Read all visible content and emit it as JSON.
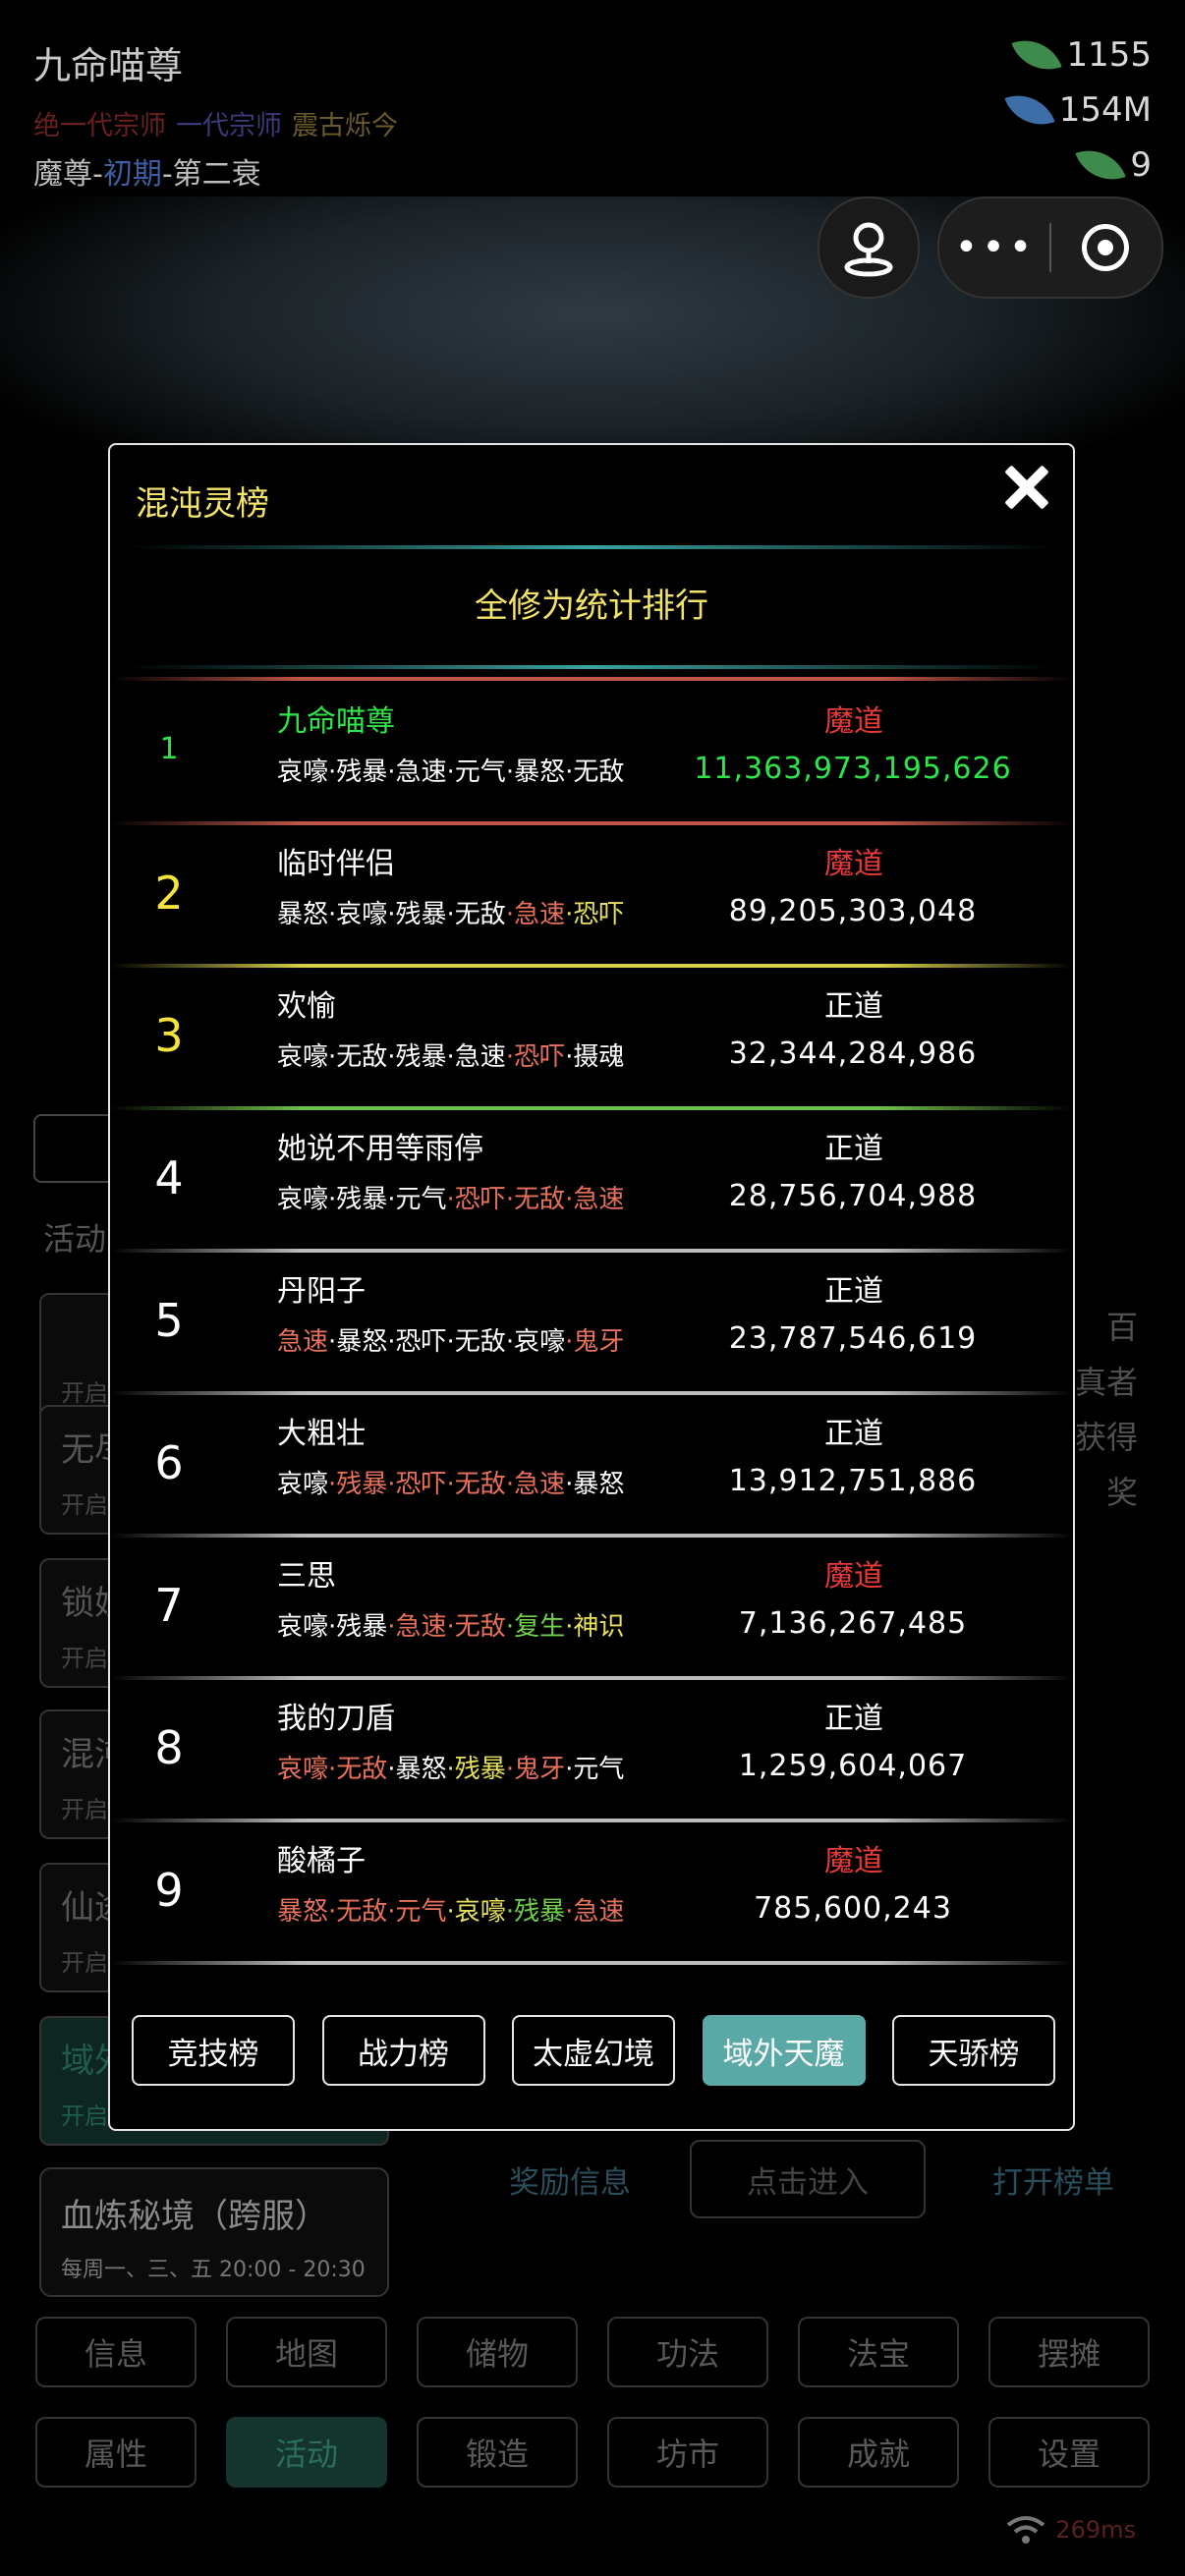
{
  "player": {
    "name": "九命喵尊",
    "titles": [
      {
        "text": "绝一代宗师",
        "color": "#6b1f1f"
      },
      {
        "text": "一代宗师",
        "color": "#3a3a7a"
      },
      {
        "text": "震古烁今",
        "color": "#6a5a2a"
      }
    ],
    "rank_prefix": "魔尊-",
    "rank_stage": "初期",
    "rank_suffix": "-第二衰"
  },
  "resources": [
    {
      "icon": "green-leaf-icon",
      "value": "1155",
      "color": "#3f8a4d"
    },
    {
      "icon": "blue-leaf-icon",
      "value": "154M",
      "color": "#3d6ea8"
    },
    {
      "icon": "green-leaf-icon",
      "value": "9",
      "color": "#3f8a4d"
    }
  ],
  "sidebar": {
    "section_label": "活动",
    "cards": [
      {
        "title": "",
        "sub": "开启"
      },
      {
        "title": "无尽",
        "sub": "开启"
      },
      {
        "title": "锁妖",
        "sub": "开启"
      },
      {
        "title": "混沌",
        "sub": "开启"
      },
      {
        "title": "仙途",
        "sub": "开启"
      },
      {
        "title": "域外",
        "sub": "开启"
      }
    ],
    "bottom_card": {
      "title": "血炼秘境（跨服）",
      "sub": "每周一、三、五 20:00 - 20:30"
    }
  },
  "right_text": [
    "百",
    "真者",
    "获得",
    "奖"
  ],
  "under_links": {
    "reward": "奖励信息",
    "enter": "点击进入",
    "open_list": "打开榜单"
  },
  "nav": {
    "row1": [
      "信息",
      "地图",
      "储物",
      "功法",
      "法宝",
      "摆摊"
    ],
    "row2": [
      "属性",
      "活动",
      "锻造",
      "坊市",
      "成就",
      "设置"
    ],
    "active": "活动"
  },
  "status": {
    "ping": "269ms"
  },
  "modal": {
    "title": "混沌灵榜",
    "subtitle": "全修为统计排行",
    "rows": [
      {
        "rank": "1",
        "name": "九命喵尊",
        "name_color": "#2fe34b",
        "rank_color": "#2fe34b",
        "rank_small": true,
        "faction": "魔道",
        "faction_color": "#e63a3a",
        "power": "11,363,973,195,626",
        "power_color": "#2fe34b",
        "skills": [
          {
            "t": "哀嚎",
            "c": "#ffffff"
          },
          {
            "t": "·残暴",
            "c": "#ffffff"
          },
          {
            "t": "·急速",
            "c": "#ffffff"
          },
          {
            "t": "·元气",
            "c": "#ffffff"
          },
          {
            "t": "·暴怒",
            "c": "#ffffff"
          },
          {
            "t": "·无敌",
            "c": "#ffffff"
          }
        ],
        "sep": "#c0564a"
      },
      {
        "rank": "2",
        "name": "临时伴侣",
        "name_color": "#ffffff",
        "rank_color": "#f5e23a",
        "faction": "魔道",
        "faction_color": "#e63a3a",
        "power": "89,205,303,048",
        "power_color": "#ffffff",
        "skills": [
          {
            "t": "暴怒",
            "c": "#ffffff"
          },
          {
            "t": "·哀嚎",
            "c": "#ffffff"
          },
          {
            "t": "·残暴",
            "c": "#ffffff"
          },
          {
            "t": "·无敌",
            "c": "#ffffff"
          },
          {
            "t": "·急速",
            "c": "#e8715a"
          },
          {
            "t": "·恐吓",
            "c": "#e7e05a"
          }
        ],
        "sep": "#d7cf4a"
      },
      {
        "rank": "3",
        "name": "欢愉",
        "name_color": "#ffffff",
        "rank_color": "#f5e23a",
        "faction": "正道",
        "faction_color": "#ffffff",
        "power": "32,344,284,986",
        "power_color": "#ffffff",
        "skills": [
          {
            "t": "哀嚎",
            "c": "#ffffff"
          },
          {
            "t": "·无敌",
            "c": "#ffffff"
          },
          {
            "t": "·残暴",
            "c": "#ffffff"
          },
          {
            "t": "·急速",
            "c": "#ffffff"
          },
          {
            "t": "·恐吓",
            "c": "#e8715a"
          },
          {
            "t": "·摄魂",
            "c": "#ffffff"
          }
        ],
        "sep": "#6fbf4a"
      },
      {
        "rank": "4",
        "name": "她说不用等雨停",
        "name_color": "#ffffff",
        "rank_color": "#ffffff",
        "faction": "正道",
        "faction_color": "#ffffff",
        "power": "28,756,704,988",
        "power_color": "#ffffff",
        "skills": [
          {
            "t": "哀嚎",
            "c": "#ffffff"
          },
          {
            "t": "·残暴",
            "c": "#ffffff"
          },
          {
            "t": "·元气",
            "c": "#ffffff"
          },
          {
            "t": "·恐吓",
            "c": "#e8715a"
          },
          {
            "t": "·无敌",
            "c": "#e8715a"
          },
          {
            "t": "·急速",
            "c": "#e8715a"
          }
        ],
        "sep": "#bbbbbb"
      },
      {
        "rank": "5",
        "name": "丹阳子",
        "name_color": "#ffffff",
        "rank_color": "#ffffff",
        "faction": "正道",
        "faction_color": "#ffffff",
        "power": "23,787,546,619",
        "power_color": "#ffffff",
        "skills": [
          {
            "t": "急速",
            "c": "#e8715a"
          },
          {
            "t": "·暴怒",
            "c": "#ffffff"
          },
          {
            "t": "·恐吓",
            "c": "#ffffff"
          },
          {
            "t": "·无敌",
            "c": "#ffffff"
          },
          {
            "t": "·哀嚎",
            "c": "#ffffff"
          },
          {
            "t": "·鬼牙",
            "c": "#e8715a"
          }
        ],
        "sep": "#bbbbbb"
      },
      {
        "rank": "6",
        "name": "大粗壮",
        "name_color": "#ffffff",
        "rank_color": "#ffffff",
        "faction": "正道",
        "faction_color": "#ffffff",
        "power": "13,912,751,886",
        "power_color": "#ffffff",
        "skills": [
          {
            "t": "哀嚎",
            "c": "#ffffff"
          },
          {
            "t": "·残暴",
            "c": "#e8715a"
          },
          {
            "t": "·恐吓",
            "c": "#e8715a"
          },
          {
            "t": "·无敌",
            "c": "#e8715a"
          },
          {
            "t": "·急速",
            "c": "#e8715a"
          },
          {
            "t": "·暴怒",
            "c": "#ffffff"
          }
        ],
        "sep": "#bbbbbb"
      },
      {
        "rank": "7",
        "name": "三思",
        "name_color": "#ffffff",
        "rank_color": "#ffffff",
        "faction": "魔道",
        "faction_color": "#e63a3a",
        "power": "7,136,267,485",
        "power_color": "#ffffff",
        "skills": [
          {
            "t": "哀嚎",
            "c": "#ffffff"
          },
          {
            "t": "·残暴",
            "c": "#ffffff"
          },
          {
            "t": "·急速",
            "c": "#e8715a"
          },
          {
            "t": "·无敌",
            "c": "#e8715a"
          },
          {
            "t": "·复生",
            "c": "#6fd04a"
          },
          {
            "t": "·神识",
            "c": "#e7e05a"
          }
        ],
        "sep": "#bbbbbb"
      },
      {
        "rank": "8",
        "name": "我的刀盾",
        "name_color": "#ffffff",
        "rank_color": "#ffffff",
        "faction": "正道",
        "faction_color": "#ffffff",
        "power": "1,259,604,067",
        "power_color": "#ffffff",
        "skills": [
          {
            "t": "哀嚎",
            "c": "#e8715a"
          },
          {
            "t": "·无敌",
            "c": "#e8715a"
          },
          {
            "t": "·暴怒",
            "c": "#ffffff"
          },
          {
            "t": "·残暴",
            "c": "#e7e05a"
          },
          {
            "t": "·鬼牙",
            "c": "#e8715a"
          },
          {
            "t": "·元气",
            "c": "#ffffff"
          }
        ],
        "sep": "#bbbbbb"
      },
      {
        "rank": "9",
        "name": "酸橘子",
        "name_color": "#ffffff",
        "rank_color": "#ffffff",
        "faction": "魔道",
        "faction_color": "#e63a3a",
        "power": "785,600,243",
        "power_color": "#ffffff",
        "skills": [
          {
            "t": "暴怒",
            "c": "#e8715a"
          },
          {
            "t": "·无敌",
            "c": "#e8715a"
          },
          {
            "t": "·元气",
            "c": "#e8715a"
          },
          {
            "t": "·哀嚎",
            "c": "#e7e05a"
          },
          {
            "t": "·残暴",
            "c": "#6fd04a"
          },
          {
            "t": "·急速",
            "c": "#e8715a"
          }
        ],
        "sep": "#bbbbbb"
      }
    ],
    "tabs": [
      "竞技榜",
      "战力榜",
      "太虚幻境",
      "域外天魔",
      "天骄榜"
    ],
    "active_tab": "域外天魔"
  }
}
